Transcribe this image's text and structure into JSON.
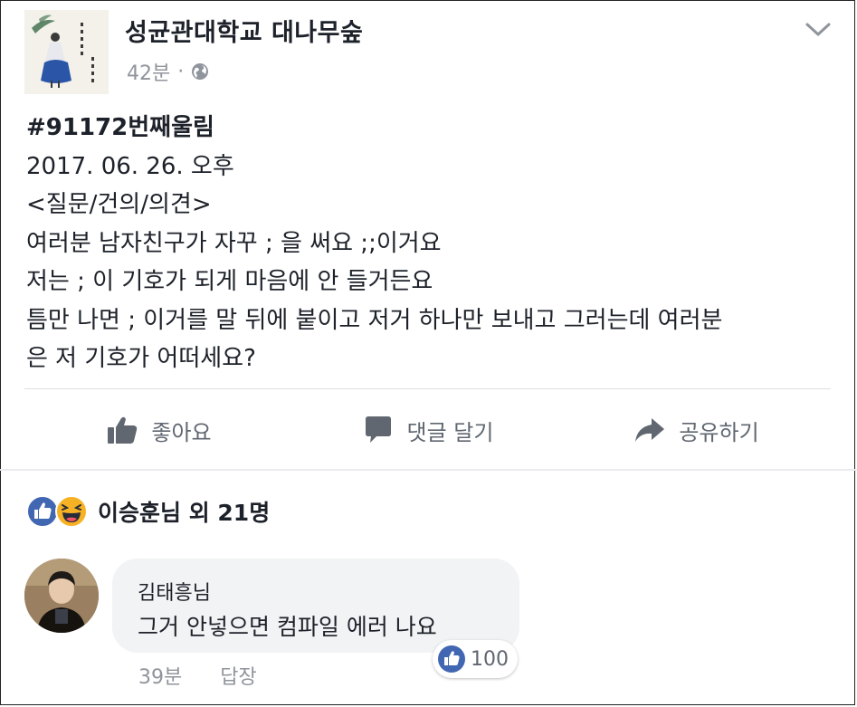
{
  "header": {
    "page_name": "성균관대학교 대나무숲",
    "time": "42분",
    "separator": "·",
    "privacy_icon": "globe-icon",
    "menu_icon": "chevron-down-icon",
    "avatar_text": "성균관대학교 대나무숲"
  },
  "post": {
    "lines": [
      "#91172번째울림",
      "2017. 06. 26. 오후",
      "<질문/건의/의견>",
      "여러분 남자친구가 자꾸 ; 을 써요 ;;이거요",
      "저는 ; 이 기호가 되게 마음에 안 들거든요",
      "틈만 나면 ; 이거를 말 뒤에 붙이고 저거 하나만 보내고 그러는데 여러분",
      "은 저 기호가 어떠세요?"
    ]
  },
  "actions": {
    "like": "좋아요",
    "comment": "댓글 달기",
    "share": "공유하기"
  },
  "reactions": {
    "summary": "이승훈님 외 21명",
    "icons": [
      "like-reaction-icon",
      "haha-reaction-icon"
    ]
  },
  "comment": {
    "author": "김태흥님",
    "text": "그거 안넣으면 컴파일 에러 나요",
    "like_count": "100",
    "time": "39분",
    "reply": "답장"
  },
  "colors": {
    "facebook_blue": "#4267b2",
    "reaction_yellow": "#f7b125",
    "secondary_text": "#90949c",
    "action_text": "#606770",
    "bubble_bg": "#f2f3f5"
  }
}
